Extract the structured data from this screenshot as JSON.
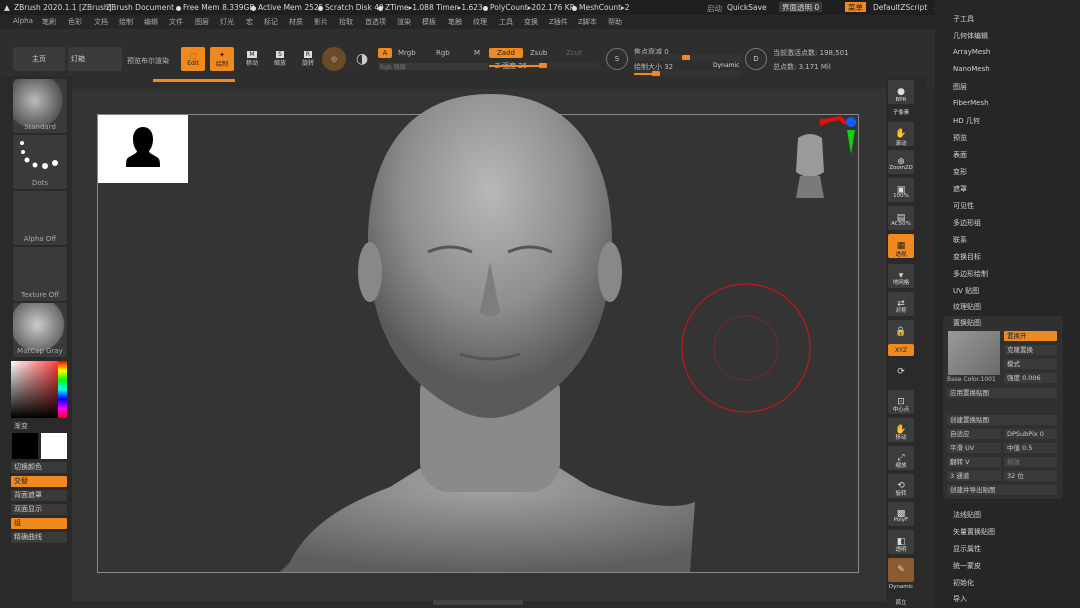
{
  "titlebar": {
    "app": "ZBrush 2020.1.1 [ZBrush]",
    "document": "ZBrush Document",
    "free_mem": "Free Mem 8.339GB",
    "active_mem": "Active Mem 2525",
    "scratch": "Scratch Disk 49",
    "ztime": "ZTime▸1.088 Timer▸1.623",
    "polycount": "PolyCount▸202.176 KP",
    "meshcount": "MeshCount▸2",
    "ao": "启动",
    "quicksave": "QuickSave",
    "interface_transparency": "界面透明 0",
    "menu": "菜单",
    "script": "DefaultZScript"
  },
  "menubar": [
    "Alpha",
    "笔刷",
    "色彩",
    "文档",
    "绘制",
    "编辑",
    "文件",
    "图层",
    "灯光",
    "宏",
    "标记",
    "材质",
    "影片",
    "拾取",
    "首选项",
    "渲染",
    "模板",
    "笔触",
    "纹理",
    "工具",
    "变换",
    "Z插件",
    "Z脚本",
    "帮助"
  ],
  "toolbar": {
    "home": "主页",
    "lightbox": "灯箱",
    "preview": "预览布尔渲染",
    "edit": "Edit",
    "draw": "绘制",
    "move": "移动",
    "scale": "缩放",
    "rotate": "旋转",
    "a": "A",
    "mrgb": "Mrgb",
    "rgb": "Rgb",
    "m": "M",
    "rgb_intensity": "Rgb 强度",
    "zadd": "Zadd",
    "zsub": "Zsub",
    "zcut": "Zcut",
    "z_intensity": "Z 强度 25",
    "z_value": 25,
    "focal_shift": "焦点衰减 0",
    "draw_size": "绘制大小 32",
    "dynamic": "Dynamic",
    "active_points": "当前激活点数: 198,501",
    "total_points": "总点数: 3.171 Mil"
  },
  "left": {
    "brush": "Standard",
    "stroke": "Dots",
    "alpha": "Alpha Off",
    "texture": "Texture Off",
    "material": "MatCap Gray",
    "gradient": "渐变",
    "switch_color": "切换颜色",
    "alternate": "交替",
    "backface_mask": "背面遮罩",
    "double_display": "双面显示",
    "group": "组",
    "precise_curve": "精确曲线"
  },
  "right_icons": [
    "BPR",
    "子像素",
    "滚动",
    "Zoom2D",
    "100%",
    "AC50%",
    "透视",
    "地网格",
    "对称",
    "XYZ",
    "中心点",
    "移动",
    "缩放",
    "旋转",
    "PolyF",
    "透明",
    "Dynamic",
    "孤立"
  ],
  "palette": {
    "items_top": [
      "子工具",
      "几何体编辑",
      "ArrayMesh",
      "NanoMesh",
      "图层",
      "FiberMesh",
      "HD 几何",
      "预览",
      "表面",
      "变形",
      "遮罩",
      "可见性",
      "多边形组",
      "联系",
      "变换目标",
      "多边形绘制",
      "UV 贴图",
      "纹理贴图",
      "置换贴图"
    ],
    "disp": {
      "on": "置换开",
      "smooth": "克隆置换",
      "mode": "模式",
      "intensity": "强度 0.006",
      "base_color": "Base Color.1001",
      "apply": "应用置换贴图",
      "create": "创建置换贴图",
      "adaptive": "自适应",
      "dpsubpix": "DPSubPix 0",
      "smooth_uv": "平滑 UV",
      "mid": "中值 0.5",
      "flip_v": "翻转 V",
      "scale": "缩放",
      "channels": "3 通道",
      "bits": "32 位",
      "create_export": "创建并导出贴图"
    },
    "items_bottom": [
      "法线贴图",
      "矢量置换贴图",
      "显示属性",
      "统一蒙皮",
      "初始化",
      "导入"
    ]
  }
}
